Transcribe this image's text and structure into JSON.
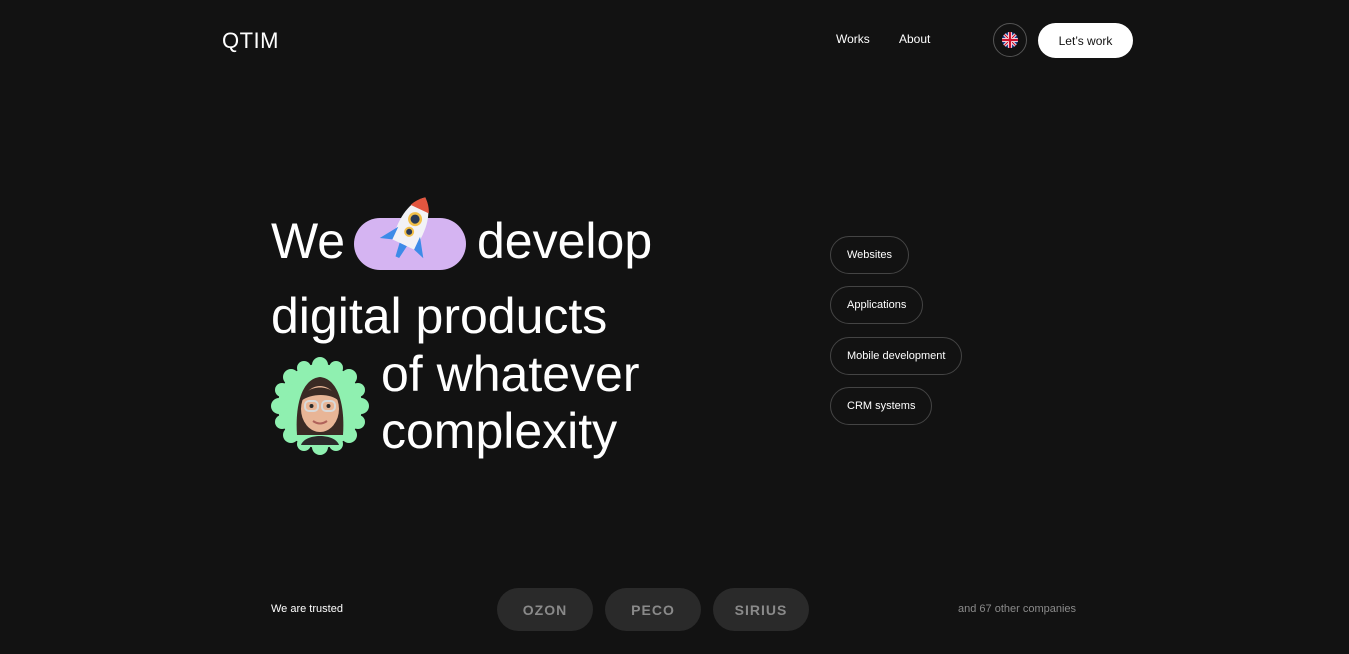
{
  "header": {
    "logo": "QTIM",
    "nav": {
      "works": "Works",
      "about": "About"
    },
    "language_icon": "uk-flag-icon",
    "cta": "Let’s work"
  },
  "hero": {
    "line1_a": "We",
    "line1_b": "develop",
    "line2": "digital products",
    "line3": "of whatever",
    "line4": "complexity",
    "accent_color": "#d5b4f2",
    "badge_color": "#8ff0b0"
  },
  "services": [
    "Websites",
    "Applications",
    "Mobile development",
    "CRM systems"
  ],
  "trusted": {
    "label": "We are trusted",
    "clients": [
      "OZON",
      "PECO",
      "SIRIUS"
    ],
    "others": "and 67 other companies"
  }
}
